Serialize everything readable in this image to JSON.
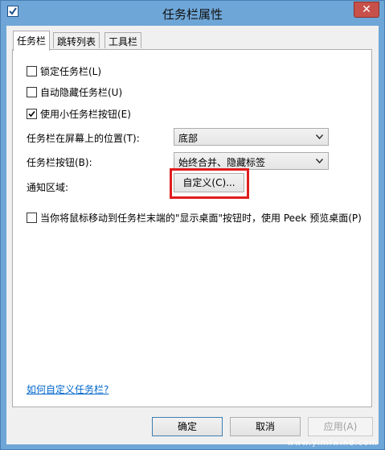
{
  "window": {
    "title": "任务栏属性",
    "close_glyph": "✕",
    "accent": "#6ea6d7",
    "highlight_color": "#e01d1d"
  },
  "tabs": [
    {
      "label": "任务栏"
    },
    {
      "label": "跳转列表"
    },
    {
      "label": "工具栏"
    }
  ],
  "options": {
    "lock_taskbar": {
      "label": "锁定任务栏(L)",
      "checked": false
    },
    "auto_hide": {
      "label": "自动隐藏任务栏(U)",
      "checked": false
    },
    "small_buttons": {
      "label": "使用小任务栏按钮(E)",
      "checked": true
    },
    "peek": {
      "label": "当你将鼠标移动到任务栏末端的\"显示桌面\"按钮时，使用 Peek 预览桌面(P)",
      "checked": false
    }
  },
  "position": {
    "label": "任务栏在屏幕上的位置(T):",
    "value": "底部"
  },
  "buttons_setting": {
    "label": "任务栏按钮(B):",
    "value": "始终合并、隐藏标签"
  },
  "notification": {
    "label": "通知区域:",
    "customize_label": "自定义(C)..."
  },
  "help_link": "如何自定义任务栏?",
  "footer": {
    "ok": "确定",
    "cancel": "取消",
    "apply": "应用(A)"
  },
  "watermark": "www.ylmfwin8.com"
}
